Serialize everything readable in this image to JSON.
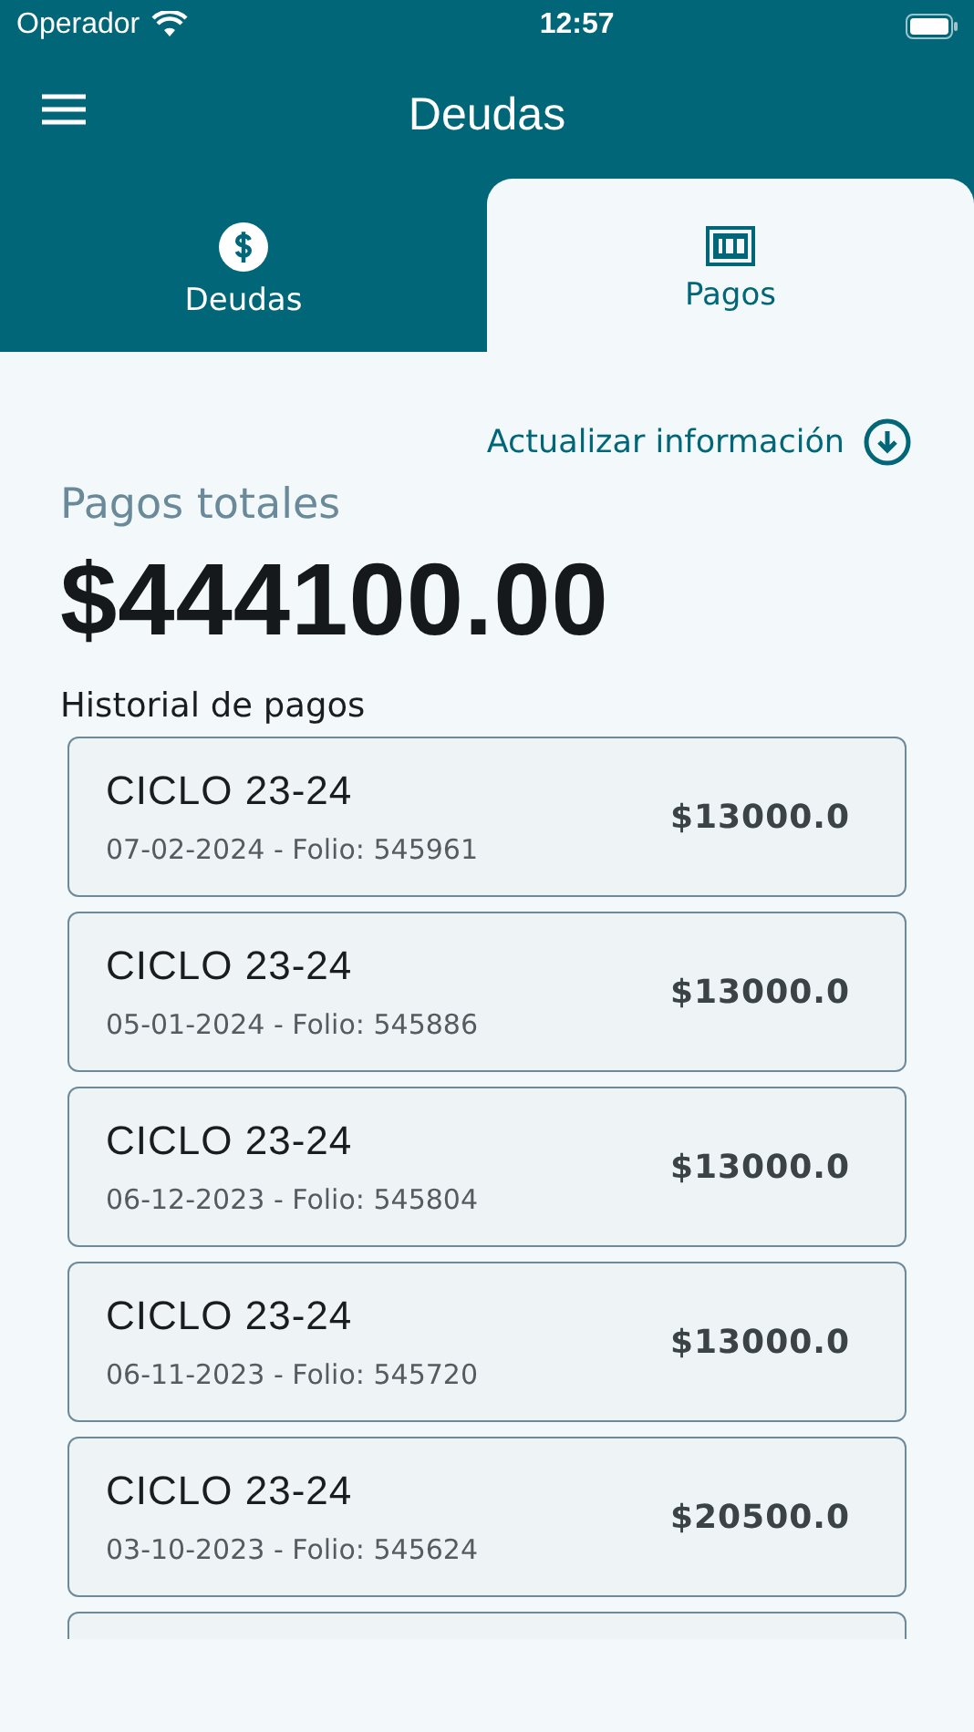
{
  "status_bar": {
    "carrier": "Operador",
    "time": "12:57"
  },
  "header": {
    "title": "Deudas"
  },
  "tabs": [
    {
      "label": "Deudas",
      "kind": "dollar",
      "selected": false
    },
    {
      "label": "Pagos",
      "kind": "bill",
      "selected": true
    }
  ],
  "refresh_link": "Actualizar información",
  "total": {
    "label": "Pagos totales",
    "amount": "$444100.00"
  },
  "history": {
    "title": "Historial de pagos",
    "payments": [
      {
        "cycle": "CICLO 23-24",
        "detail": "07-02-2024 - Folio: 545961",
        "amount": "$13000.0"
      },
      {
        "cycle": "CICLO 23-24",
        "detail": "05-01-2024 - Folio: 545886",
        "amount": "$13000.0"
      },
      {
        "cycle": "CICLO 23-24",
        "detail": "06-12-2023 - Folio: 545804",
        "amount": "$13000.0"
      },
      {
        "cycle": "CICLO 23-24",
        "detail": "06-11-2023 - Folio: 545720",
        "amount": "$13000.0"
      },
      {
        "cycle": "CICLO 23-24",
        "detail": "03-10-2023 - Folio: 545624",
        "amount": "$20500.0"
      }
    ]
  }
}
